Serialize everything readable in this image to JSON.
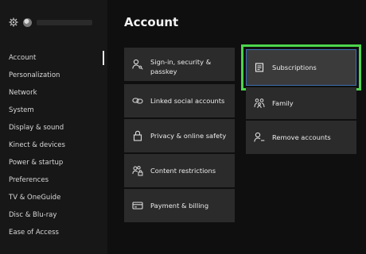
{
  "header": {
    "title": "Account"
  },
  "sidebar": {
    "items": [
      {
        "label": "Account",
        "selected": true
      },
      {
        "label": "Personalization"
      },
      {
        "label": "Network"
      },
      {
        "label": "System"
      },
      {
        "label": "Display & sound"
      },
      {
        "label": "Kinect & devices"
      },
      {
        "label": "Power & startup"
      },
      {
        "label": "Preferences"
      },
      {
        "label": "TV & OneGuide"
      },
      {
        "label": "Disc & Blu-ray"
      },
      {
        "label": "Ease of Access"
      }
    ]
  },
  "tiles": {
    "signin": {
      "label_line1": "Sign-in, security &",
      "label_line2": "passkey",
      "icon": "person-key-icon"
    },
    "linked": {
      "label": "Linked social accounts",
      "icon": "link-icon"
    },
    "privacy": {
      "label": "Privacy & online safety",
      "icon": "lock-icon"
    },
    "content": {
      "label": "Content restrictions",
      "icon": "people-lock-icon"
    },
    "payment": {
      "label": "Payment & billing",
      "icon": "credit-card-icon"
    },
    "subscriptions": {
      "label": "Subscriptions",
      "icon": "document-icon"
    },
    "family": {
      "label": "Family",
      "icon": "family-icon"
    },
    "remove": {
      "label": "Remove accounts",
      "icon": "person-minus-icon"
    }
  },
  "colors": {
    "focus_outline": "#4cd64c",
    "focus_inner": "#3f6fb3",
    "tile": "#2b2b2b",
    "background": "#0f0f0f"
  }
}
